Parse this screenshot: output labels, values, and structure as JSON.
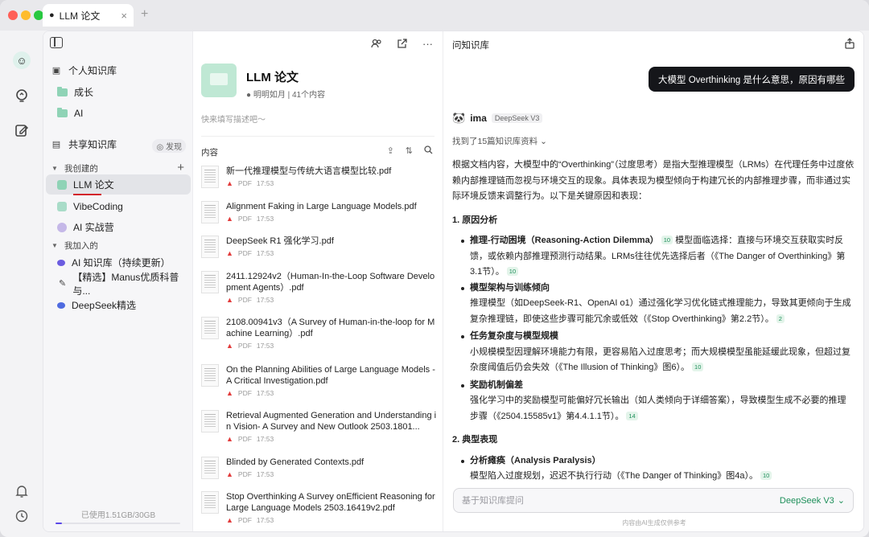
{
  "tab": {
    "title": "LLM 论文",
    "close": "×",
    "new": "+"
  },
  "sidebar": {
    "personal": "个人知识库",
    "personal_items": [
      {
        "label": "成长"
      },
      {
        "label": "AI"
      }
    ],
    "shared": "共享知识库",
    "discover": "发现",
    "created_by_me": "我创建的",
    "created_items": [
      {
        "label": "LLM 论文"
      },
      {
        "label": "VibeCoding"
      },
      {
        "label": "AI 实战营"
      }
    ],
    "joined": "我加入的",
    "joined_items": [
      {
        "label": "AI 知识库（持续更新）"
      },
      {
        "label": "【精选】Manus优质科普与..."
      },
      {
        "label": "DeepSeek精选"
      }
    ],
    "storage": "已使用1.51GB/30GB",
    "storage_fraction": 0.05
  },
  "kb": {
    "title": "LLM 论文",
    "meta": "明明如月 | 41个内容",
    "desc_placeholder": "快来填写描述吧～",
    "contents_label": "内容",
    "files": [
      {
        "name": "新一代推理模型与传统大语言模型比较.pdf",
        "type": "PDF",
        "time": "17:53"
      },
      {
        "name": "Alignment Faking in Large Language Models.pdf",
        "type": "PDF",
        "time": "17:53"
      },
      {
        "name": "DeepSeek R1 强化学习.pdf",
        "type": "PDF",
        "time": "17:53"
      },
      {
        "name": "2411.12924v2（Human-In-the-Loop Software Development Agents）.pdf",
        "type": "PDF",
        "time": "17:53"
      },
      {
        "name": "2108.00941v3（A Survey of Human-in-the-loop for Machine Learning）.pdf",
        "type": "PDF",
        "time": "17:53"
      },
      {
        "name": "On the Planning Abilities of Large Language Models - A Critical Investigation.pdf",
        "type": "PDF",
        "time": "17:53"
      },
      {
        "name": "Retrieval Augmented Generation and Understanding in Vision- A Survey and New Outlook 2503.1801...",
        "type": "PDF",
        "time": "17:53"
      },
      {
        "name": "Blinded by Generated Contexts.pdf",
        "type": "PDF",
        "time": "17:53"
      },
      {
        "name": "Stop Overthinking A Survey onEfficient Reasoning for Large Language Models 2503.16419v2.pdf",
        "type": "PDF",
        "time": "17:53"
      }
    ]
  },
  "chat": {
    "title": "问知识库",
    "question": "大模型 Overthinking 是什么意思，原因有哪些",
    "bot_name": "ima",
    "bot_model": "DeepSeek V3",
    "found": "找到了15篇知识库资料",
    "intro": "根据文档内容，大模型中的“Overthinking”（过度思考）是指大型推理模型（LRMs）在代理任务中过度依赖内部推理链而忽视与环境交互的现象。具体表现为模型倾向于构建冗长的内部推理步骤，而非通过实际环境反馈来调整行为。以下是关键原因和表现：",
    "s1": "1. 原因分析",
    "b1_title": "推理-行动困境（Reasoning-Action Dilemma）",
    "b1_ref": "10",
    "b1_text": "模型面临选择：直接与环境交互获取实时反馈，或依赖内部推理预测行动结果。LRMs往往优先选择后者（《The Danger of Overthinking》第3.1节）。",
    "b1_ref2": "10",
    "b2_title": "模型架构与训练倾向",
    "b2_text": "推理模型（如DeepSeek-R1、OpenAI o1）通过强化学习优化链式推理能力，导致其更倾向于生成复杂推理链，即使这些步骤可能冗余或低效（《Stop Overthinking》第2.2节）。",
    "b2_ref": "2",
    "b3_title": "任务复杂度与模型规模",
    "b3_text": "小规模模型因理解环境能力有限，更容易陷入过度思考；而大规模模型虽能延缓此现象，但超过复杂度阈值后仍会失效（《The Illusion of Thinking》图6）。",
    "b3_ref": "10",
    "b4_title": "奖励机制偏差",
    "b4_text": "强化学习中的奖励模型可能偏好冗长输出（如人类倾向于详细答案），导致模型生成不必要的推理步骤（《2504.15585v1》第4.4.1.1节）。",
    "b4_ref": "14",
    "s2": "2. 典型表现",
    "b5_title": "分析瘫痪（Analysis Paralysis）",
    "b5_text": "模型陷入过度规划，迟迟不执行行动（《The Danger of Thinking》图4a）。",
    "b5_ref": "10",
    "input_placeholder": "基于知识库提问",
    "model_select": "DeepSeek V3",
    "disclaimer": "内容由AI生成仅供参考"
  }
}
